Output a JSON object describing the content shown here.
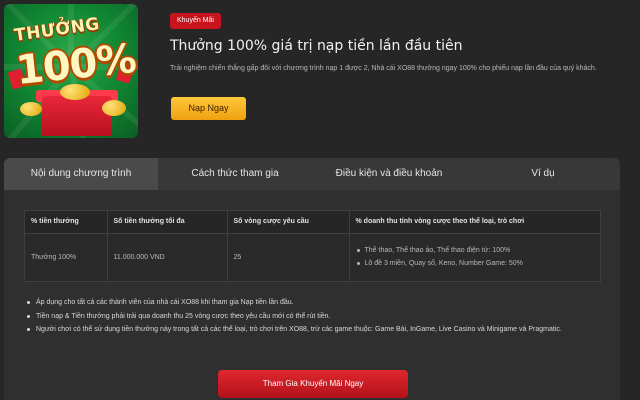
{
  "banner": {
    "word": "THƯỞNG",
    "percent": "100%",
    "colors": {
      "background": "#118a34",
      "gift": "#e8283a",
      "text": "#fff3b0"
    }
  },
  "promo": {
    "tag": "Khuyến Mãi",
    "title": "Thưởng 100% giá trị nạp tiền lần đầu tiên",
    "description": "Trải nghiệm chiến thắng gấp đôi với chương trình nạp 1 được 2, Nhà cái XO88 thưởng ngay 100% cho phiếu nạp lần đầu của quý khách.",
    "cta_label": "Nạp Ngay"
  },
  "tabs": [
    {
      "label": "Nội dung chương trình",
      "active": true
    },
    {
      "label": "Cách thức tham gia",
      "active": false
    },
    {
      "label": "Điều kiện và điều khoản",
      "active": false
    },
    {
      "label": "Ví dụ",
      "active": false
    }
  ],
  "table": {
    "headers": [
      "% tiền thưởng",
      "Số tiền thưởng tối đa",
      "Số vòng cược yêu cầu",
      "% doanh thu tính vòng cược theo thể loại, trò chơi"
    ],
    "row": {
      "bonus_percent": "Thưởng 100%",
      "max_bonus": "11.000.000 VND",
      "rounds": "25",
      "revenue_items": [
        "Thể thao, Thể thao ảo, Thể thao điện tử: 100%",
        "Lô đề 3 miền, Quay số, Keno, Number Game: 50%"
      ]
    }
  },
  "notes": [
    "Áp dụng cho tất cả các thành viên của nhà cái XO88 khi tham gia Nạp tiền lần đầu.",
    "Tiền nạp & Tiền thưởng phải trải qua doanh thu 25 vòng cược theo yêu cầu mới có thể rút tiền.",
    "Người chơi có thể sử dụng tiền thưởng này trong tất cả các thể loại, trò chơi trên XO88, trừ các game thuộc: Game Bài, InGame, Live Casino và Minigame và Pragmatic."
  ],
  "join_label": "Tham Gia Khuyến Mãi Ngay",
  "colors": {
    "accent_red": "#c8141c",
    "accent_yellow": "#ffc83a",
    "background": "#262626"
  }
}
